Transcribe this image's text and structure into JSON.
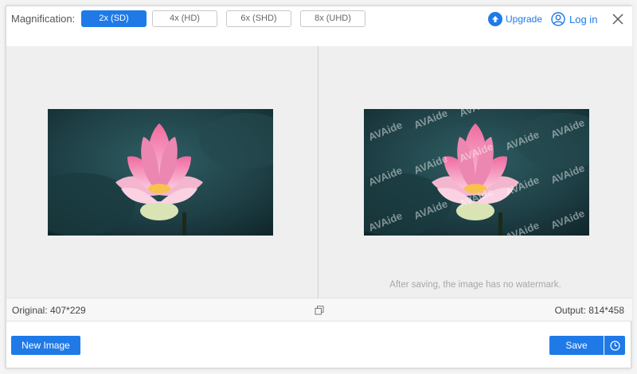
{
  "header": {
    "magnification_label": "Magnification:",
    "options": [
      {
        "label": "2x (SD)",
        "selected": true
      },
      {
        "label": "4x (HD)",
        "selected": false
      },
      {
        "label": "6x (SHD)",
        "selected": false
      },
      {
        "label": "8x (UHD)",
        "selected": false
      }
    ],
    "upgrade_label": "Upgrade",
    "login_label": "Log in"
  },
  "preview": {
    "note": "After saving, the image has no watermark.",
    "watermark_text": "AVAide"
  },
  "info": {
    "original": "Original: 407*229",
    "output": "Output: 814*458"
  },
  "footer": {
    "new_image_label": "New Image",
    "save_label": "Save"
  },
  "colors": {
    "accent": "#1f7ae8",
    "preview_bg": "#efefef"
  },
  "icons": [
    "upgrade-icon",
    "user-icon",
    "close-icon",
    "compare-icon",
    "clock-icon"
  ]
}
